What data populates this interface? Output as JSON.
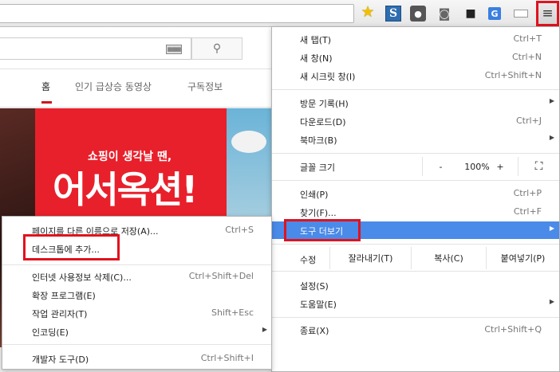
{
  "toolbar": {
    "icons": [
      "star-icon",
      "s-extension-icon",
      "bulb-extension-icon",
      "camera-icon",
      "video-extension-icon",
      "translate-extension-icon",
      "window-icon",
      "menu-icon"
    ],
    "ext_s_label": "S",
    "translate_label": "G",
    "menu_glyph": "≡"
  },
  "youtube": {
    "tabs": [
      "홈",
      "인기 급상승 동영상",
      "구독정보"
    ],
    "keyboard_glyph": "▦▦▦",
    "search_glyph": "⚲",
    "banner_subtitle": "쇼핑이 생각날 땐,",
    "banner_title": "어서옥션!",
    "accent_color": "#cc181e"
  },
  "chrome_menu": {
    "items": [
      {
        "label": "새 탭(T)",
        "shortcut": "Ctrl+T"
      },
      {
        "label": "새 창(N)",
        "shortcut": "Ctrl+N"
      },
      {
        "label": "새 시크릿 창(I)",
        "shortcut": "Ctrl+Shift+N"
      },
      {
        "label": "방문 기록(H)",
        "shortcut": ""
      },
      {
        "label": "다운로드(D)",
        "shortcut": "Ctrl+J"
      },
      {
        "label": "북마크(B)",
        "shortcut": ""
      },
      {
        "label": "인쇄(P)",
        "shortcut": "Ctrl+P"
      },
      {
        "label": "찾기(F)...",
        "shortcut": "Ctrl+F"
      },
      {
        "label": "도구 더보기",
        "shortcut": ""
      },
      {
        "label": "설정(S)",
        "shortcut": ""
      },
      {
        "label": "도움말(E)",
        "shortcut": ""
      },
      {
        "label": "종료(X)",
        "shortcut": "Ctrl+Shift+Q"
      }
    ],
    "zoom": {
      "label": "글꼴 크기",
      "minus": "-",
      "value": "100%",
      "plus": "+",
      "fullscreen": "⛶"
    },
    "edit": {
      "label": "수정",
      "cut": "잘라내기(T)",
      "copy": "복사(C)",
      "paste": "붙여넣기(P)"
    },
    "highlight_color": "#4a8ae8"
  },
  "sub_menu": {
    "items": [
      {
        "label": "페이지를 다른 이름으로 저장(A)...",
        "shortcut": "Ctrl+S"
      },
      {
        "label": "데스크톱에 추가...",
        "shortcut": ""
      },
      {
        "label": "인터넷 사용정보 삭제(C)...",
        "shortcut": "Ctrl+Shift+Del"
      },
      {
        "label": "확장 프로그램(E)",
        "shortcut": ""
      },
      {
        "label": "작업 관리자(T)",
        "shortcut": "Shift+Esc"
      },
      {
        "label": "인코딩(E)",
        "shortcut": ""
      },
      {
        "label": "개발자 도구(D)",
        "shortcut": "Ctrl+Shift+I"
      }
    ]
  },
  "annotation_color": "#e0121e"
}
